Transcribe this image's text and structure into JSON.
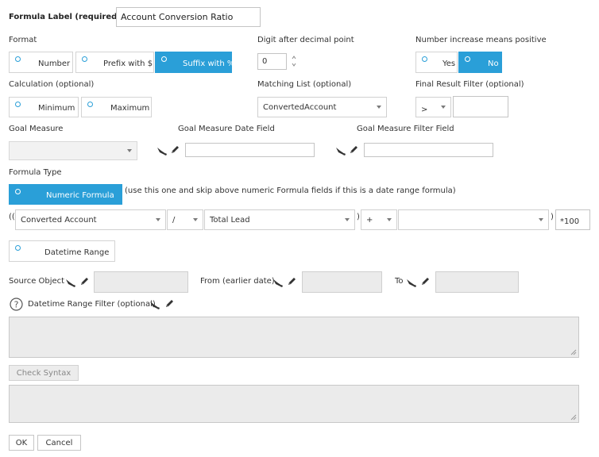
{
  "formula_label": {
    "label": "Formula Label (required)",
    "value": "Account Conversion Ratio"
  },
  "format": {
    "label": "Format",
    "options": [
      "Number",
      "Prefix with $",
      "Suffix with %"
    ],
    "selected": "Suffix with %"
  },
  "decimal": {
    "label": "Digit after decimal point",
    "value": "0"
  },
  "positive": {
    "label": "Number increase means positive",
    "options": [
      "Yes",
      "No"
    ],
    "selected": "No"
  },
  "calculation": {
    "label": "Calculation (optional)",
    "options": [
      "Minimum",
      "Maximum"
    ]
  },
  "matching_list": {
    "label": "Matching List (optional)",
    "value": "ConvertedAccount"
  },
  "final_filter": {
    "label": "Final Result Filter (optional)",
    "operator": ">",
    "value": ""
  },
  "goal_measure": {
    "label": "Goal Measure",
    "value": ""
  },
  "goal_date": {
    "label": "Goal Measure Date Field",
    "value": ""
  },
  "goal_filter": {
    "label": "Goal Measure Filter Field",
    "value": ""
  },
  "formula_type": {
    "label": "Formula Type",
    "numeric_label": "Numeric Formula",
    "hint": "(use this one and skip above numeric Formula fields if this is a date range formula)",
    "datetime_label": "Datetime Range"
  },
  "formula": {
    "open": "((",
    "field1": "Converted Account",
    "operator1": "/",
    "field2": "Total Lead",
    "close1": ")",
    "operator2": "+",
    "field3": "",
    "close2": ")",
    "multiplier": "*100"
  },
  "datetime": {
    "source_label": "Source Object",
    "from_label": "From (earlier date)",
    "to_label": "To",
    "filter_label": "Datetime Range Filter (optional)"
  },
  "buttons": {
    "check_syntax": "Check Syntax",
    "ok": "OK",
    "cancel": "Cancel"
  },
  "colors": {
    "accent": "#2a9fd8",
    "disabled_bg": "#ebebeb"
  },
  "icons": [
    "brush-icon",
    "pencil-icon",
    "help-icon",
    "spinner-arrows-icon",
    "chevron-down-icon"
  ]
}
